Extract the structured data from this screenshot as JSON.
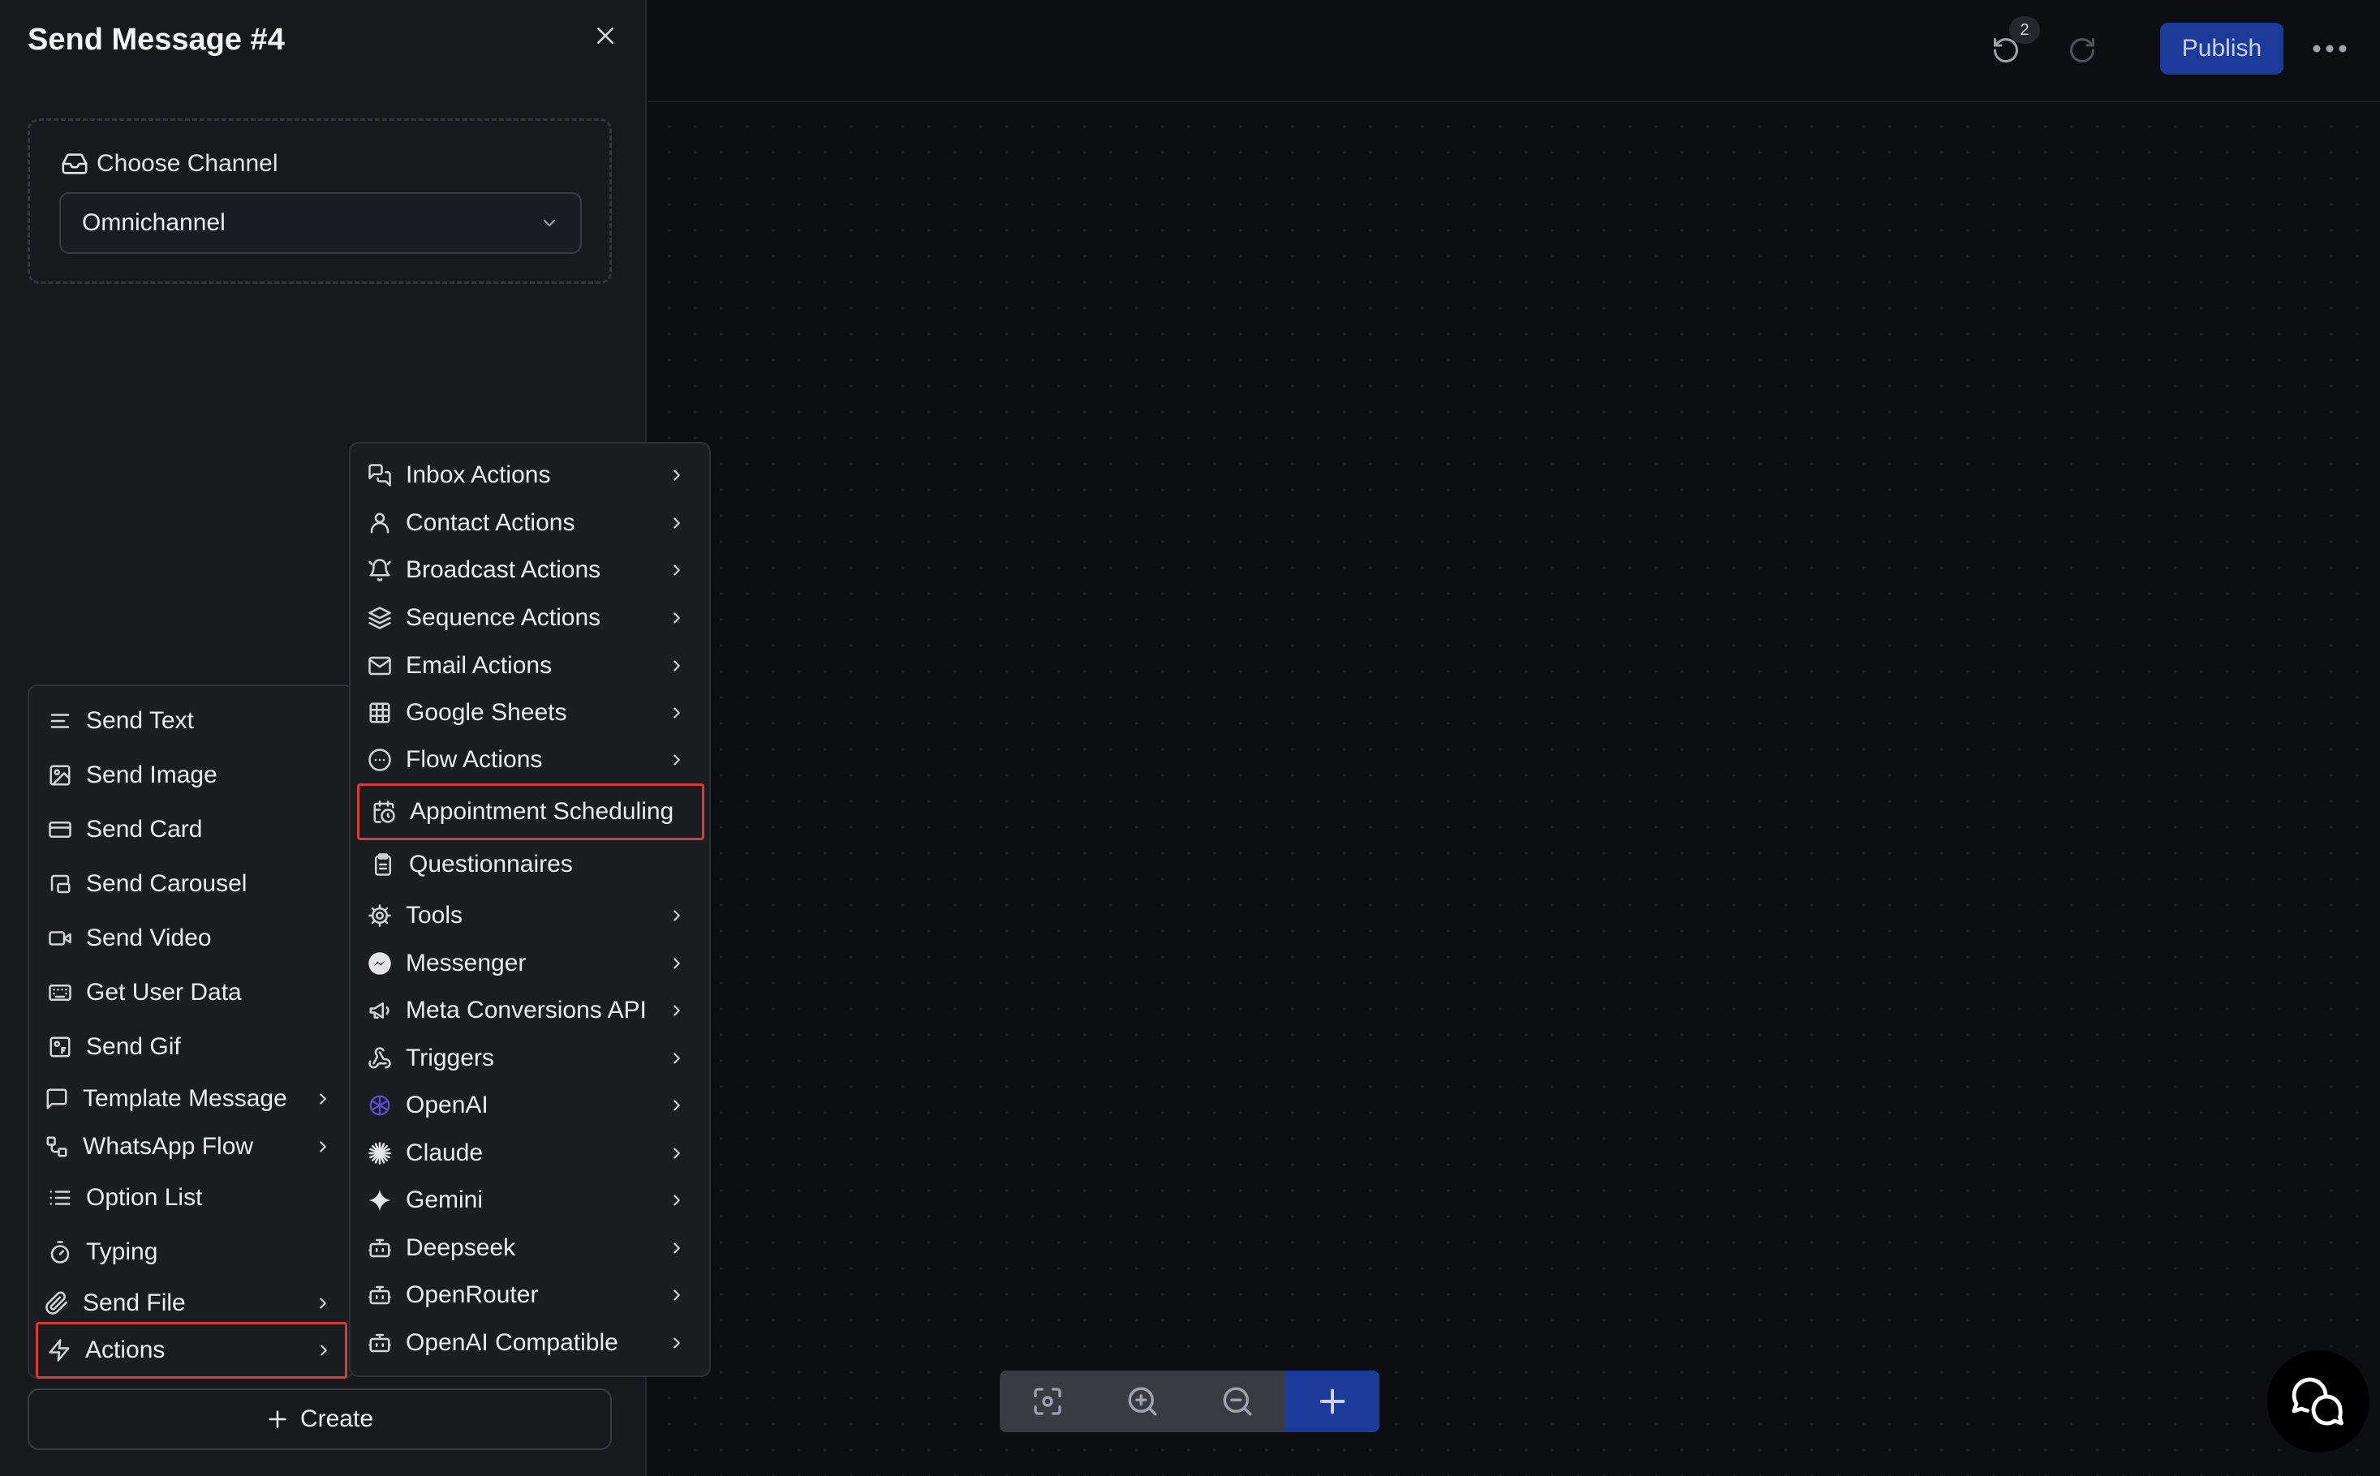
{
  "panel": {
    "title": "Send Message #4",
    "channel": {
      "label": "Choose Channel",
      "value": "Omnichannel"
    },
    "create_label": "Create"
  },
  "topbar": {
    "undo_badge": "2",
    "publish_label": "Publish"
  },
  "message_menu": {
    "items": [
      {
        "label": "Send Text",
        "icon": "text-lines-icon"
      },
      {
        "label": "Send Image",
        "icon": "image-icon"
      },
      {
        "label": "Send Card",
        "icon": "card-icon"
      },
      {
        "label": "Send Carousel",
        "icon": "carousel-icon"
      },
      {
        "label": "Send Video",
        "icon": "video-icon"
      },
      {
        "label": "Get User Data",
        "icon": "keyboard-icon"
      },
      {
        "label": "Send Gif",
        "icon": "gif-icon"
      },
      {
        "label": "Template Message",
        "icon": "message-square-icon",
        "submenu": true
      },
      {
        "label": "WhatsApp Flow",
        "icon": "flow-icon",
        "submenu": true
      },
      {
        "label": "Option List",
        "icon": "list-icon"
      },
      {
        "label": "Typing",
        "icon": "timer-icon"
      },
      {
        "label": "Send File",
        "icon": "paperclip-icon",
        "submenu": true
      },
      {
        "label": "Actions",
        "icon": "lightning-icon",
        "submenu": true,
        "selected": true
      }
    ]
  },
  "actions_menu": {
    "items": [
      {
        "label": "Inbox Actions",
        "icon": "inbox-chat-icon",
        "submenu": true
      },
      {
        "label": "Contact Actions",
        "icon": "user-icon",
        "submenu": true
      },
      {
        "label": "Broadcast Actions",
        "icon": "bell-icon",
        "submenu": true
      },
      {
        "label": "Sequence Actions",
        "icon": "layers-icon",
        "submenu": true
      },
      {
        "label": "Email Actions",
        "icon": "mail-icon",
        "submenu": true
      },
      {
        "label": "Google Sheets",
        "icon": "sheet-grid-icon",
        "submenu": true
      },
      {
        "label": "Flow Actions",
        "icon": "dots-circle-icon",
        "submenu": true
      },
      {
        "label": "Appointment Scheduling",
        "icon": "calendar-clock-icon",
        "highlight": true
      },
      {
        "label": "Questionnaires",
        "icon": "clipboard-icon"
      },
      {
        "label": "Tools",
        "icon": "gear-icon",
        "submenu": true
      },
      {
        "label": "Messenger",
        "icon": "messenger-icon",
        "submenu": true
      },
      {
        "label": "Meta Conversions API",
        "icon": "megaphone-icon",
        "submenu": true
      },
      {
        "label": "Triggers",
        "icon": "webhook-icon",
        "submenu": true
      },
      {
        "label": "OpenAI",
        "icon": "openai-icon",
        "submenu": true
      },
      {
        "label": "Claude",
        "icon": "claude-icon",
        "submenu": true
      },
      {
        "label": "Gemini",
        "icon": "gemini-icon",
        "submenu": true
      },
      {
        "label": "Deepseek",
        "icon": "bot-icon",
        "submenu": true
      },
      {
        "label": "OpenRouter",
        "icon": "bot-icon",
        "submenu": true
      },
      {
        "label": "OpenAI Compatible",
        "icon": "bot-icon",
        "submenu": true
      }
    ]
  },
  "colors": {
    "accent": "#1c3a9a",
    "highlight_border": "#d83b3b",
    "panel_bg": "#18191d",
    "canvas_bg": "#0d0e12"
  }
}
